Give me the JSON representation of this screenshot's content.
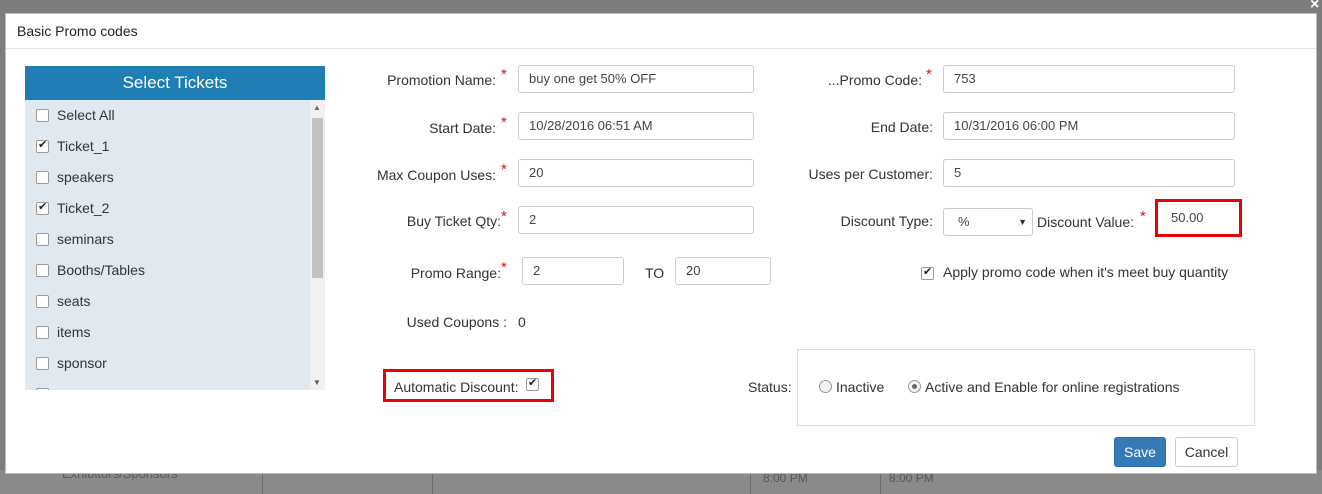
{
  "backdrop": {
    "row_text": "Exhibitors/Sponsors",
    "times": [
      "8:00 PM",
      "8:00 PM"
    ]
  },
  "modal": {
    "title": "Basic Promo codes"
  },
  "tickets": {
    "heading": "Select Tickets",
    "items": [
      {
        "label": "Select All",
        "checked": false
      },
      {
        "label": "Ticket_1",
        "checked": true
      },
      {
        "label": "speakers",
        "checked": false
      },
      {
        "label": "Ticket_2",
        "checked": true
      },
      {
        "label": "seminars",
        "checked": false
      },
      {
        "label": "Booths/Tables",
        "checked": false
      },
      {
        "label": "seats",
        "checked": false
      },
      {
        "label": "items",
        "checked": false
      },
      {
        "label": "sponsor",
        "checked": false
      }
    ]
  },
  "form": {
    "promotion_name": {
      "label": "Promotion Name:",
      "value": "buy one get 50% OFF"
    },
    "promo_code": {
      "label": "...Promo Code:",
      "value": "753"
    },
    "start_date": {
      "label": "Start Date:",
      "value": "10/28/2016 06:51 AM"
    },
    "end_date": {
      "label": "End Date:",
      "value": "10/31/2016 06:00 PM"
    },
    "max_coupon_uses": {
      "label": "Max Coupon Uses:",
      "value": "20"
    },
    "uses_per_customer": {
      "label": "Uses per Customer:",
      "value": "5"
    },
    "buy_ticket_qty": {
      "label": "Buy Ticket Qty:",
      "value": "2"
    },
    "discount_type": {
      "label": "Discount Type:",
      "value": "%"
    },
    "discount_value": {
      "label": "Discount Value:",
      "value": "50.00"
    },
    "promo_range": {
      "label": "Promo Range:",
      "from": "2",
      "to_label": "TO",
      "to": "20"
    },
    "apply_promo": {
      "label": "Apply promo code when it's meet buy quantity",
      "checked": true
    },
    "used_coupons": {
      "label": "Used Coupons :",
      "value": "0"
    },
    "automatic_discount": {
      "label": "Automatic Discount:",
      "checked": true
    },
    "status": {
      "label": "Status:",
      "options": [
        {
          "label": "Inactive",
          "selected": false
        },
        {
          "label": "Active and Enable for online registrations",
          "selected": true
        }
      ]
    }
  },
  "actions": {
    "save": "Save",
    "cancel": "Cancel"
  },
  "colors": {
    "primary": "#337ab7",
    "header": "#1f7fb5",
    "highlight": "#e00000",
    "required": "#dd1111"
  }
}
